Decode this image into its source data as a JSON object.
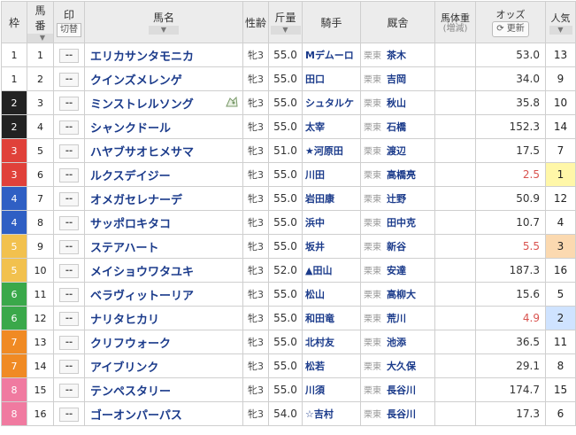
{
  "headers": {
    "waku": "枠",
    "umaban_1": "馬",
    "umaban_2": "番",
    "mark": "印",
    "mark_toggle": "切替",
    "name": "馬名",
    "sex_age": "性齢",
    "weight": "斤量",
    "jockey": "騎手",
    "stable": "厩舎",
    "body_weight": "馬体重",
    "body_weight_sub": "(増減)",
    "odds": "オッズ",
    "update": "更新",
    "popularity_1": "人気",
    "dropdown_glyph": "▼"
  },
  "mark_placeholder": "--",
  "frame_colors": {
    "1": {
      "bg": "#ffffff",
      "fg": "#222222"
    },
    "2": {
      "bg": "#222222",
      "fg": "#ffffff"
    },
    "3": {
      "bg": "#e0413a",
      "fg": "#ffffff"
    },
    "4": {
      "bg": "#2f5fc4",
      "fg": "#ffffff"
    },
    "5": {
      "bg": "#f2c14e",
      "fg": "#ffffff"
    },
    "6": {
      "bg": "#3aa84a",
      "fg": "#ffffff"
    },
    "7": {
      "bg": "#f08a24",
      "fg": "#ffffff"
    },
    "8": {
      "bg": "#f07aa0",
      "fg": "#ffffff"
    }
  },
  "horses": [
    {
      "waku": "1",
      "num": "1",
      "name": "エリカサンタモニカ",
      "sex": "牝3",
      "wt": "55.0",
      "jockey": "Mデムーロ",
      "aff": "栗東",
      "trainer": "茶木",
      "odds": "53.0",
      "odds_hot": false,
      "pop": "13"
    },
    {
      "waku": "1",
      "num": "2",
      "name": "クインズメレンゲ",
      "sex": "牝3",
      "wt": "55.0",
      "jockey": "田口",
      "aff": "栗東",
      "trainer": "吉岡",
      "odds": "34.0",
      "odds_hot": false,
      "pop": "9"
    },
    {
      "waku": "2",
      "num": "3",
      "name": "ミンストレルソング",
      "sex": "牝3",
      "wt": "55.0",
      "jockey": "シュタルケ",
      "aff": "栗東",
      "trainer": "秋山",
      "odds": "35.8",
      "odds_hot": false,
      "pop": "10",
      "blinker": true
    },
    {
      "waku": "2",
      "num": "4",
      "name": "シャンクドール",
      "sex": "牝3",
      "wt": "55.0",
      "jockey": "太宰",
      "aff": "栗東",
      "trainer": "石橋",
      "odds": "152.3",
      "odds_hot": false,
      "pop": "14"
    },
    {
      "waku": "3",
      "num": "5",
      "name": "ハヤブサオヒメサマ",
      "sex": "牝3",
      "wt": "51.0",
      "jockey": "★河原田",
      "aff": "栗東",
      "trainer": "渡辺",
      "odds": "17.5",
      "odds_hot": false,
      "pop": "7"
    },
    {
      "waku": "3",
      "num": "6",
      "name": "ルクスデイジー",
      "sex": "牝3",
      "wt": "55.0",
      "jockey": "川田",
      "aff": "栗東",
      "trainer": "高橋亮",
      "odds": "2.5",
      "odds_hot": true,
      "pop": "1"
    },
    {
      "waku": "4",
      "num": "7",
      "name": "オメガセレナーデ",
      "sex": "牝3",
      "wt": "55.0",
      "jockey": "岩田康",
      "aff": "栗東",
      "trainer": "辻野",
      "odds": "50.9",
      "odds_hot": false,
      "pop": "12"
    },
    {
      "waku": "4",
      "num": "8",
      "name": "サッポロキタコ",
      "sex": "牝3",
      "wt": "55.0",
      "jockey": "浜中",
      "aff": "栗東",
      "trainer": "田中克",
      "odds": "10.7",
      "odds_hot": false,
      "pop": "4"
    },
    {
      "waku": "5",
      "num": "9",
      "name": "ステアハート",
      "sex": "牝3",
      "wt": "55.0",
      "jockey": "坂井",
      "aff": "栗東",
      "trainer": "新谷",
      "odds": "5.5",
      "odds_hot": true,
      "pop": "3"
    },
    {
      "waku": "5",
      "num": "10",
      "name": "メイショウワタユキ",
      "sex": "牝3",
      "wt": "52.0",
      "jockey": "▲田山",
      "aff": "栗東",
      "trainer": "安達",
      "odds": "187.3",
      "odds_hot": false,
      "pop": "16"
    },
    {
      "waku": "6",
      "num": "11",
      "name": "ベラヴィットーリア",
      "sex": "牝3",
      "wt": "55.0",
      "jockey": "松山",
      "aff": "栗東",
      "trainer": "高柳大",
      "odds": "15.6",
      "odds_hot": false,
      "pop": "5"
    },
    {
      "waku": "6",
      "num": "12",
      "name": "ナリタヒカリ",
      "sex": "牝3",
      "wt": "55.0",
      "jockey": "和田竜",
      "aff": "栗東",
      "trainer": "荒川",
      "odds": "4.9",
      "odds_hot": true,
      "pop": "2"
    },
    {
      "waku": "7",
      "num": "13",
      "name": "クリフウォーク",
      "sex": "牝3",
      "wt": "55.0",
      "jockey": "北村友",
      "aff": "栗東",
      "trainer": "池添",
      "odds": "36.5",
      "odds_hot": false,
      "pop": "11"
    },
    {
      "waku": "7",
      "num": "14",
      "name": "アイブリンク",
      "sex": "牝3",
      "wt": "55.0",
      "jockey": "松若",
      "aff": "栗東",
      "trainer": "大久保",
      "odds": "29.1",
      "odds_hot": false,
      "pop": "8"
    },
    {
      "waku": "8",
      "num": "15",
      "name": "テンペスタリー",
      "sex": "牝3",
      "wt": "55.0",
      "jockey": "川須",
      "aff": "栗東",
      "trainer": "長谷川",
      "odds": "174.7",
      "odds_hot": false,
      "pop": "15"
    },
    {
      "waku": "8",
      "num": "16",
      "name": "ゴーオンパーパス",
      "sex": "牝3",
      "wt": "54.0",
      "jockey": "☆吉村",
      "aff": "栗東",
      "trainer": "長谷川",
      "odds": "17.3",
      "odds_hot": false,
      "pop": "6"
    }
  ]
}
